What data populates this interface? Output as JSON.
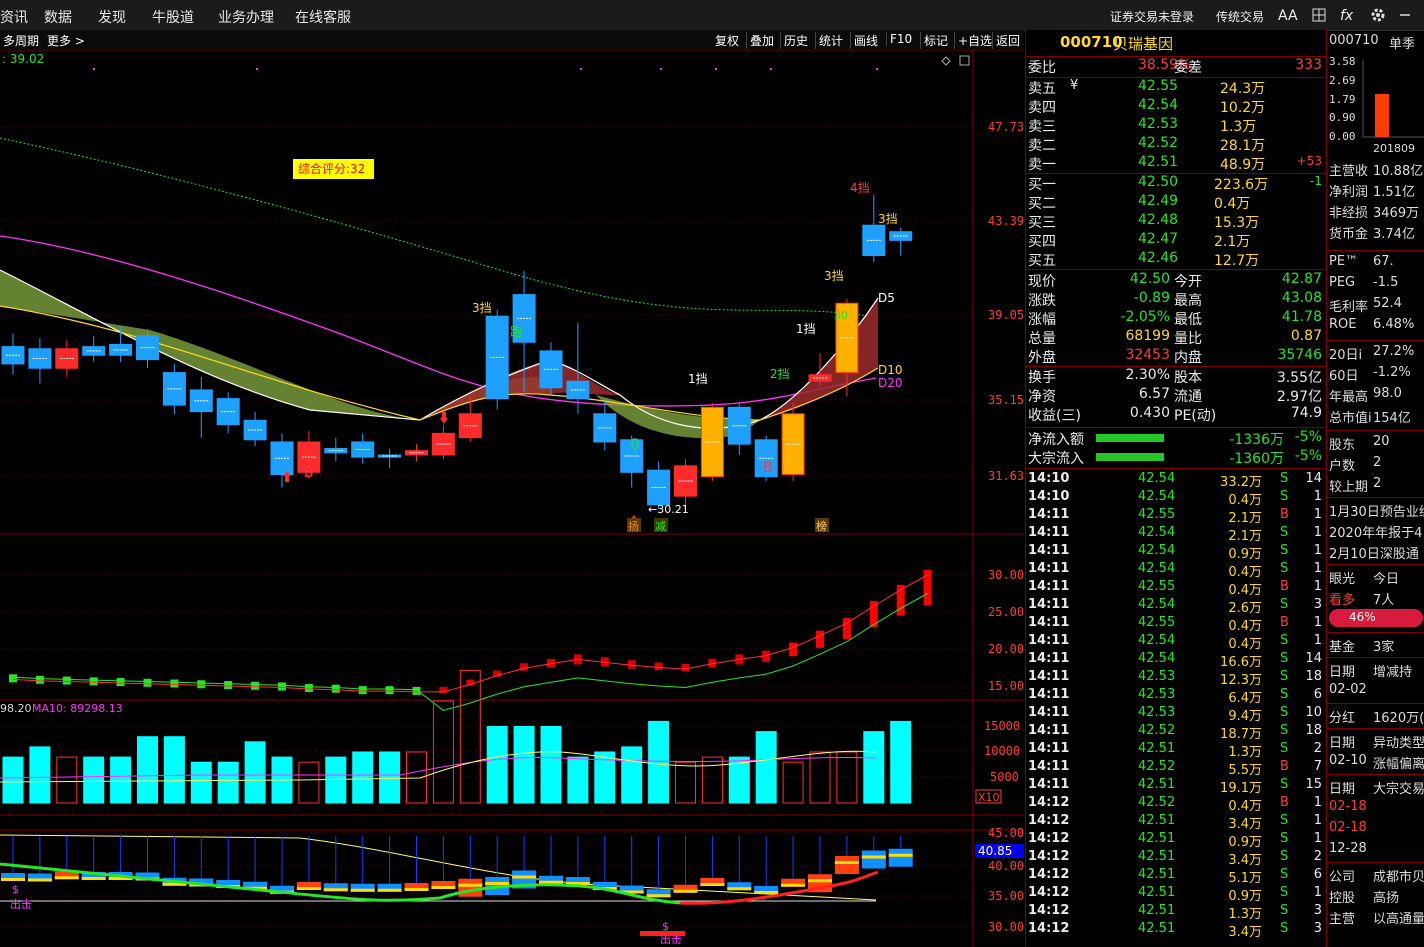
{
  "topbar": {
    "menu": [
      "资讯",
      "数据",
      "发现",
      "牛股道",
      "业务办理",
      "在线客服"
    ],
    "login": "证券交易未登录",
    "trad": "传统交易",
    "aa": "AA",
    "fx": "fx"
  },
  "toolbar": {
    "left": [
      "多周期",
      "更多 >"
    ],
    "right": [
      "复权",
      "叠加",
      "历史",
      "统计",
      "画线",
      "F10",
      "标记",
      "+自选",
      "返回"
    ]
  },
  "chart": {
    "ma_readout": ": 39.02",
    "score": "综合评分:32",
    "price_axis": [
      "47.73",
      "43.39",
      "39.05",
      "35.15",
      "31.63"
    ],
    "ind1_axis": [
      "30.00",
      "25.00",
      "20.00",
      "15.00"
    ],
    "vol_axis": [
      "15000",
      "10000",
      "5000",
      "X10"
    ],
    "vol_header": "98.20",
    "vol_ma10": "MA10: 89298.13",
    "ind3_axis": [
      "45.00",
      "40.00",
      "35.00",
      "30.00"
    ],
    "ind3_current": "40.85",
    "low_label": "←30.21",
    "dang": {
      "d4": "4挡",
      "d3a": "3挡",
      "d3b": "3挡",
      "d3c": "3挡",
      "d1a": "1挡",
      "d1b": "1挡",
      "d2": "2挡"
    },
    "signals": {
      "b1": "B",
      "b2": "B",
      "d5": "D5",
      "d10": "D10",
      "d20": "D20",
      "pao": "跑",
      "k30": "30"
    },
    "tags": {
      "t1": "扬",
      "t2": "减",
      "t3": "榜"
    },
    "chuji": "出击",
    "dollar": "$",
    "candles": [
      {
        "o": 37.6,
        "c": 36.8,
        "h": 38.2,
        "l": 36.3
      },
      {
        "o": 37.5,
        "c": 36.6,
        "h": 38.0,
        "l": 35.9
      },
      {
        "o": 36.6,
        "c": 37.5,
        "h": 37.9,
        "l": 36.2
      },
      {
        "o": 37.6,
        "c": 37.2,
        "h": 38.1,
        "l": 36.9
      },
      {
        "o": 37.7,
        "c": 37.2,
        "h": 38.5,
        "l": 36.9
      },
      {
        "o": 38.1,
        "c": 37.0,
        "h": 38.4,
        "l": 36.6
      },
      {
        "o": 36.4,
        "c": 34.9,
        "h": 36.8,
        "l": 34.5
      },
      {
        "o": 35.6,
        "c": 34.6,
        "h": 36.2,
        "l": 33.4
      },
      {
        "o": 35.2,
        "c": 34.0,
        "h": 35.5,
        "l": 33.6
      },
      {
        "o": 34.2,
        "c": 33.3,
        "h": 34.6,
        "l": 33.0
      },
      {
        "o": 33.2,
        "c": 31.7,
        "h": 33.6,
        "l": 31.1
      },
      {
        "o": 31.8,
        "c": 33.2,
        "h": 33.7,
        "l": 31.5
      },
      {
        "o": 32.9,
        "c": 32.7,
        "h": 33.4,
        "l": 32.3
      },
      {
        "o": 33.2,
        "c": 32.5,
        "h": 33.6,
        "l": 32.2
      },
      {
        "o": 32.6,
        "c": 32.5,
        "h": 32.9,
        "l": 32.0
      },
      {
        "o": 32.6,
        "c": 32.8,
        "h": 33.1,
        "l": 32.3
      },
      {
        "o": 32.6,
        "c": 33.6,
        "h": 34.0,
        "l": 32.4
      },
      {
        "o": 33.4,
        "c": 34.5,
        "h": 35.3,
        "l": 33.2
      },
      {
        "o": 39.0,
        "c": 35.2,
        "h": 39.3,
        "l": 34.7
      },
      {
        "o": 40.0,
        "c": 37.8,
        "h": 41.1,
        "l": 35.5
      },
      {
        "o": 37.4,
        "c": 35.7,
        "h": 37.8,
        "l": 35.4
      },
      {
        "o": 36.0,
        "c": 35.2,
        "h": 38.7,
        "l": 34.5
      },
      {
        "o": 34.5,
        "c": 33.2,
        "h": 35.1,
        "l": 32.8
      },
      {
        "o": 33.3,
        "c": 31.8,
        "h": 33.5,
        "l": 31.1
      },
      {
        "o": 31.9,
        "c": 30.3,
        "h": 32.3,
        "l": 30.1
      },
      {
        "o": 30.7,
        "c": 32.1,
        "h": 32.4,
        "l": 30.3
      },
      {
        "o": 31.6,
        "c": 34.8,
        "h": 35.0,
        "l": 31.4
      },
      {
        "o": 34.8,
        "c": 33.1,
        "h": 35.0,
        "l": 32.6
      },
      {
        "o": 33.3,
        "c": 31.6,
        "h": 33.5,
        "l": 31.4
      },
      {
        "o": 31.7,
        "c": 34.5,
        "h": 35.0,
        "l": 31.4
      },
      {
        "o": 36.0,
        "c": 36.3,
        "h": 37.3,
        "l": 35.8
      },
      {
        "o": 36.4,
        "c": 39.6,
        "h": 39.8,
        "l": 35.3
      },
      {
        "o": 43.2,
        "c": 41.8,
        "h": 44.6,
        "l": 41.5
      },
      {
        "o": 42.9,
        "c": 42.5,
        "h": 43.1,
        "l": 41.8
      }
    ],
    "vol": [
      9,
      11,
      9,
      9,
      9,
      13,
      13,
      8,
      8,
      12,
      9,
      8,
      9,
      10,
      10,
      10,
      20,
      26,
      15,
      15,
      15,
      9,
      10,
      11,
      16,
      8,
      9,
      9,
      14,
      8,
      10,
      10,
      14,
      16,
      20,
      14
    ],
    "ind1": [
      15.9,
      15.7,
      15.6,
      15.5,
      15.4,
      15.3,
      15.2,
      15.1,
      15.0,
      14.9,
      14.8,
      14.6,
      14.5,
      14.3,
      14.3,
      14.2,
      14.2,
      15.2,
      16.4,
      17.4,
      18.0,
      18.6,
      18.2,
      17.8,
      17.5,
      17.3,
      18.0,
      18.6,
      19.1,
      20.2,
      21.8,
      23.5,
      25.8,
      28.0,
      30.0
    ]
  },
  "quote": {
    "code": "000710",
    "name": "贝瑞基因",
    "weibi_label": "委比",
    "weibi": "38.59%",
    "weicha_label": "委差",
    "weicha": "333",
    "asks": [
      {
        "label": "卖五",
        "sym": "¥",
        "price": "42.55",
        "vol": "24.3万",
        "chg": ""
      },
      {
        "label": "卖四",
        "sym": "",
        "price": "42.54",
        "vol": "10.2万",
        "chg": ""
      },
      {
        "label": "卖三",
        "sym": "",
        "price": "42.53",
        "vol": "1.3万",
        "chg": ""
      },
      {
        "label": "卖二",
        "sym": "",
        "price": "42.52",
        "vol": "28.1万",
        "chg": ""
      },
      {
        "label": "卖一",
        "sym": "",
        "price": "42.51",
        "vol": "48.9万",
        "chg": "+53"
      }
    ],
    "bids": [
      {
        "label": "买一",
        "price": "42.50",
        "vol": "223.6万",
        "chg": "-1"
      },
      {
        "label": "买二",
        "price": "42.49",
        "vol": "0.4万",
        "chg": ""
      },
      {
        "label": "买三",
        "price": "42.48",
        "vol": "15.3万",
        "chg": ""
      },
      {
        "label": "买四",
        "price": "42.47",
        "vol": "2.1万",
        "chg": ""
      },
      {
        "label": "买五",
        "price": "42.46",
        "vol": "12.7万",
        "chg": ""
      }
    ],
    "stats": [
      {
        "l1": "现价",
        "v1": "42.50",
        "l2": "今开",
        "v2": "42.87",
        "c1": "green",
        "c2": "green"
      },
      {
        "l1": "涨跌",
        "v1": "-0.89",
        "l2": "最高",
        "v2": "43.08",
        "c1": "green",
        "c2": "green"
      },
      {
        "l1": "涨幅",
        "v1": "-2.05%",
        "l2": "最低",
        "v2": "41.78",
        "c1": "green",
        "c2": "green"
      },
      {
        "l1": "总量",
        "v1": "68199",
        "l2": "量比",
        "v2": "0.87",
        "c1": "yellow",
        "c2": "yellow"
      },
      {
        "l1": "外盘",
        "v1": "32453",
        "l2": "内盘",
        "v2": "35746",
        "c1": "red",
        "c2": "green"
      }
    ],
    "stats2": [
      {
        "l1": "换手",
        "v1": "2.30%",
        "l2": "股本",
        "v2": "3.55亿"
      },
      {
        "l1": "净资",
        "v1": "6.57",
        "l2": "流通",
        "v2": "2.97亿"
      },
      {
        "l1": "收益(三)",
        "v1": "0.430",
        "l2": "PE(动)",
        "v2": "74.9"
      }
    ],
    "flows": [
      {
        "label": "净流入额",
        "val": "-1336万",
        "pct": "-5%"
      },
      {
        "label": "大宗流入",
        "val": "-1360万",
        "pct": "-5%"
      }
    ],
    "trades": [
      [
        "14:10",
        "42.54",
        "33.2万",
        "S",
        "14"
      ],
      [
        "14:10",
        "42.54",
        "0.4万",
        "S",
        "1"
      ],
      [
        "14:11",
        "42.55",
        "2.1万",
        "B",
        "1"
      ],
      [
        "14:11",
        "42.54",
        "2.1万",
        "S",
        "1"
      ],
      [
        "14:11",
        "42.54",
        "0.9万",
        "S",
        "1"
      ],
      [
        "14:11",
        "42.54",
        "0.4万",
        "S",
        "1"
      ],
      [
        "14:11",
        "42.55",
        "0.4万",
        "B",
        "1"
      ],
      [
        "14:11",
        "42.54",
        "2.6万",
        "S",
        "3"
      ],
      [
        "14:11",
        "42.55",
        "0.4万",
        "B",
        "1"
      ],
      [
        "14:11",
        "42.54",
        "0.4万",
        "S",
        "1"
      ],
      [
        "14:11",
        "42.54",
        "16.6万",
        "S",
        "14"
      ],
      [
        "14:11",
        "42.53",
        "12.3万",
        "S",
        "18"
      ],
      [
        "14:11",
        "42.53",
        "6.4万",
        "S",
        "6"
      ],
      [
        "14:11",
        "42.53",
        "9.4万",
        "S",
        "10"
      ],
      [
        "14:11",
        "42.52",
        "18.7万",
        "S",
        "18"
      ],
      [
        "14:11",
        "42.51",
        "1.3万",
        "S",
        "2"
      ],
      [
        "14:11",
        "42.52",
        "5.5万",
        "B",
        "7"
      ],
      [
        "14:11",
        "42.51",
        "19.1万",
        "S",
        "15"
      ],
      [
        "14:12",
        "42.52",
        "0.4万",
        "B",
        "1"
      ],
      [
        "14:12",
        "42.51",
        "3.4万",
        "S",
        "1"
      ],
      [
        "14:12",
        "42.51",
        "0.9万",
        "S",
        "1"
      ],
      [
        "14:12",
        "42.51",
        "3.4万",
        "S",
        "2"
      ],
      [
        "14:12",
        "42.51",
        "5.1万",
        "S",
        "6"
      ],
      [
        "14:12",
        "42.51",
        "0.9万",
        "S",
        "1"
      ],
      [
        "14:12",
        "42.51",
        "1.3万",
        "S",
        "3"
      ],
      [
        "14:12",
        "42.51",
        "3.4万",
        "S",
        "3"
      ]
    ]
  },
  "side": {
    "code": "000710",
    "tab": "单季",
    "axis": [
      "3.58",
      "2.69",
      "1.79",
      "0.90",
      "0.00"
    ],
    "bar_period": "201809",
    "bar_value": 2.0,
    "fin": [
      {
        "l": "主营收",
        "v": "10.88亿"
      },
      {
        "l": "净利润",
        "v": "1.51亿"
      },
      {
        "l": "非经损",
        "v": "3469万"
      },
      {
        "l": "货币金",
        "v": "3.74亿"
      }
    ],
    "ratios": [
      {
        "l": "PE™",
        "v": "67."
      },
      {
        "l": "PEG",
        "v": "-1.5"
      },
      {
        "l": "毛利率",
        "v": "52.4"
      },
      {
        "l": "ROE",
        "v": "6.48%"
      }
    ],
    "perf": [
      {
        "l": "20日i",
        "v": "27.2%"
      },
      {
        "l": "60日",
        "v": "-1.2%"
      },
      {
        "l": "年最高",
        "v": "98.0"
      },
      {
        "l": "总市值i",
        "v": "154亿"
      }
    ],
    "holders": [
      {
        "l": "股东",
        "v": "20"
      },
      {
        "l": "户数",
        "v": "2"
      },
      {
        "l": "较上期",
        "v": "2"
      }
    ],
    "news": [
      "1月30日预告业绩",
      "2020年年报于4",
      "2月10日深股通"
    ],
    "eye_label": "眼光",
    "eye_right": "今日",
    "bull_label": "看多",
    "bull_count": "7人",
    "bull_pct": "46%",
    "fund_label": "基金",
    "fund_val": "3家",
    "date1_l": "日期",
    "date1_r": "增减持",
    "date1_v": "02-02",
    "fenhong_l": "分红",
    "fenhong_v": "1620万(1",
    "date2_l": "日期",
    "date2_r": "异动类型",
    "date2_v": "02-10",
    "date2_t": "涨幅偏离",
    "date3_l": "日期",
    "date3_r": "大宗交易",
    "date3_vals": [
      "02-18",
      "02-18",
      "12-28"
    ],
    "company_l": "公司",
    "company_v": "成都市贝瑞",
    "holder_l": "控股",
    "holder_v": "高扬",
    "main_l": "主营",
    "main_v": "以高通量"
  },
  "colors": {
    "up": "#ff2a2a",
    "down": "#1ea0ff",
    "green": "#26e626",
    "yellow": "#ffdb1c",
    "magenta": "#ff33ff"
  }
}
